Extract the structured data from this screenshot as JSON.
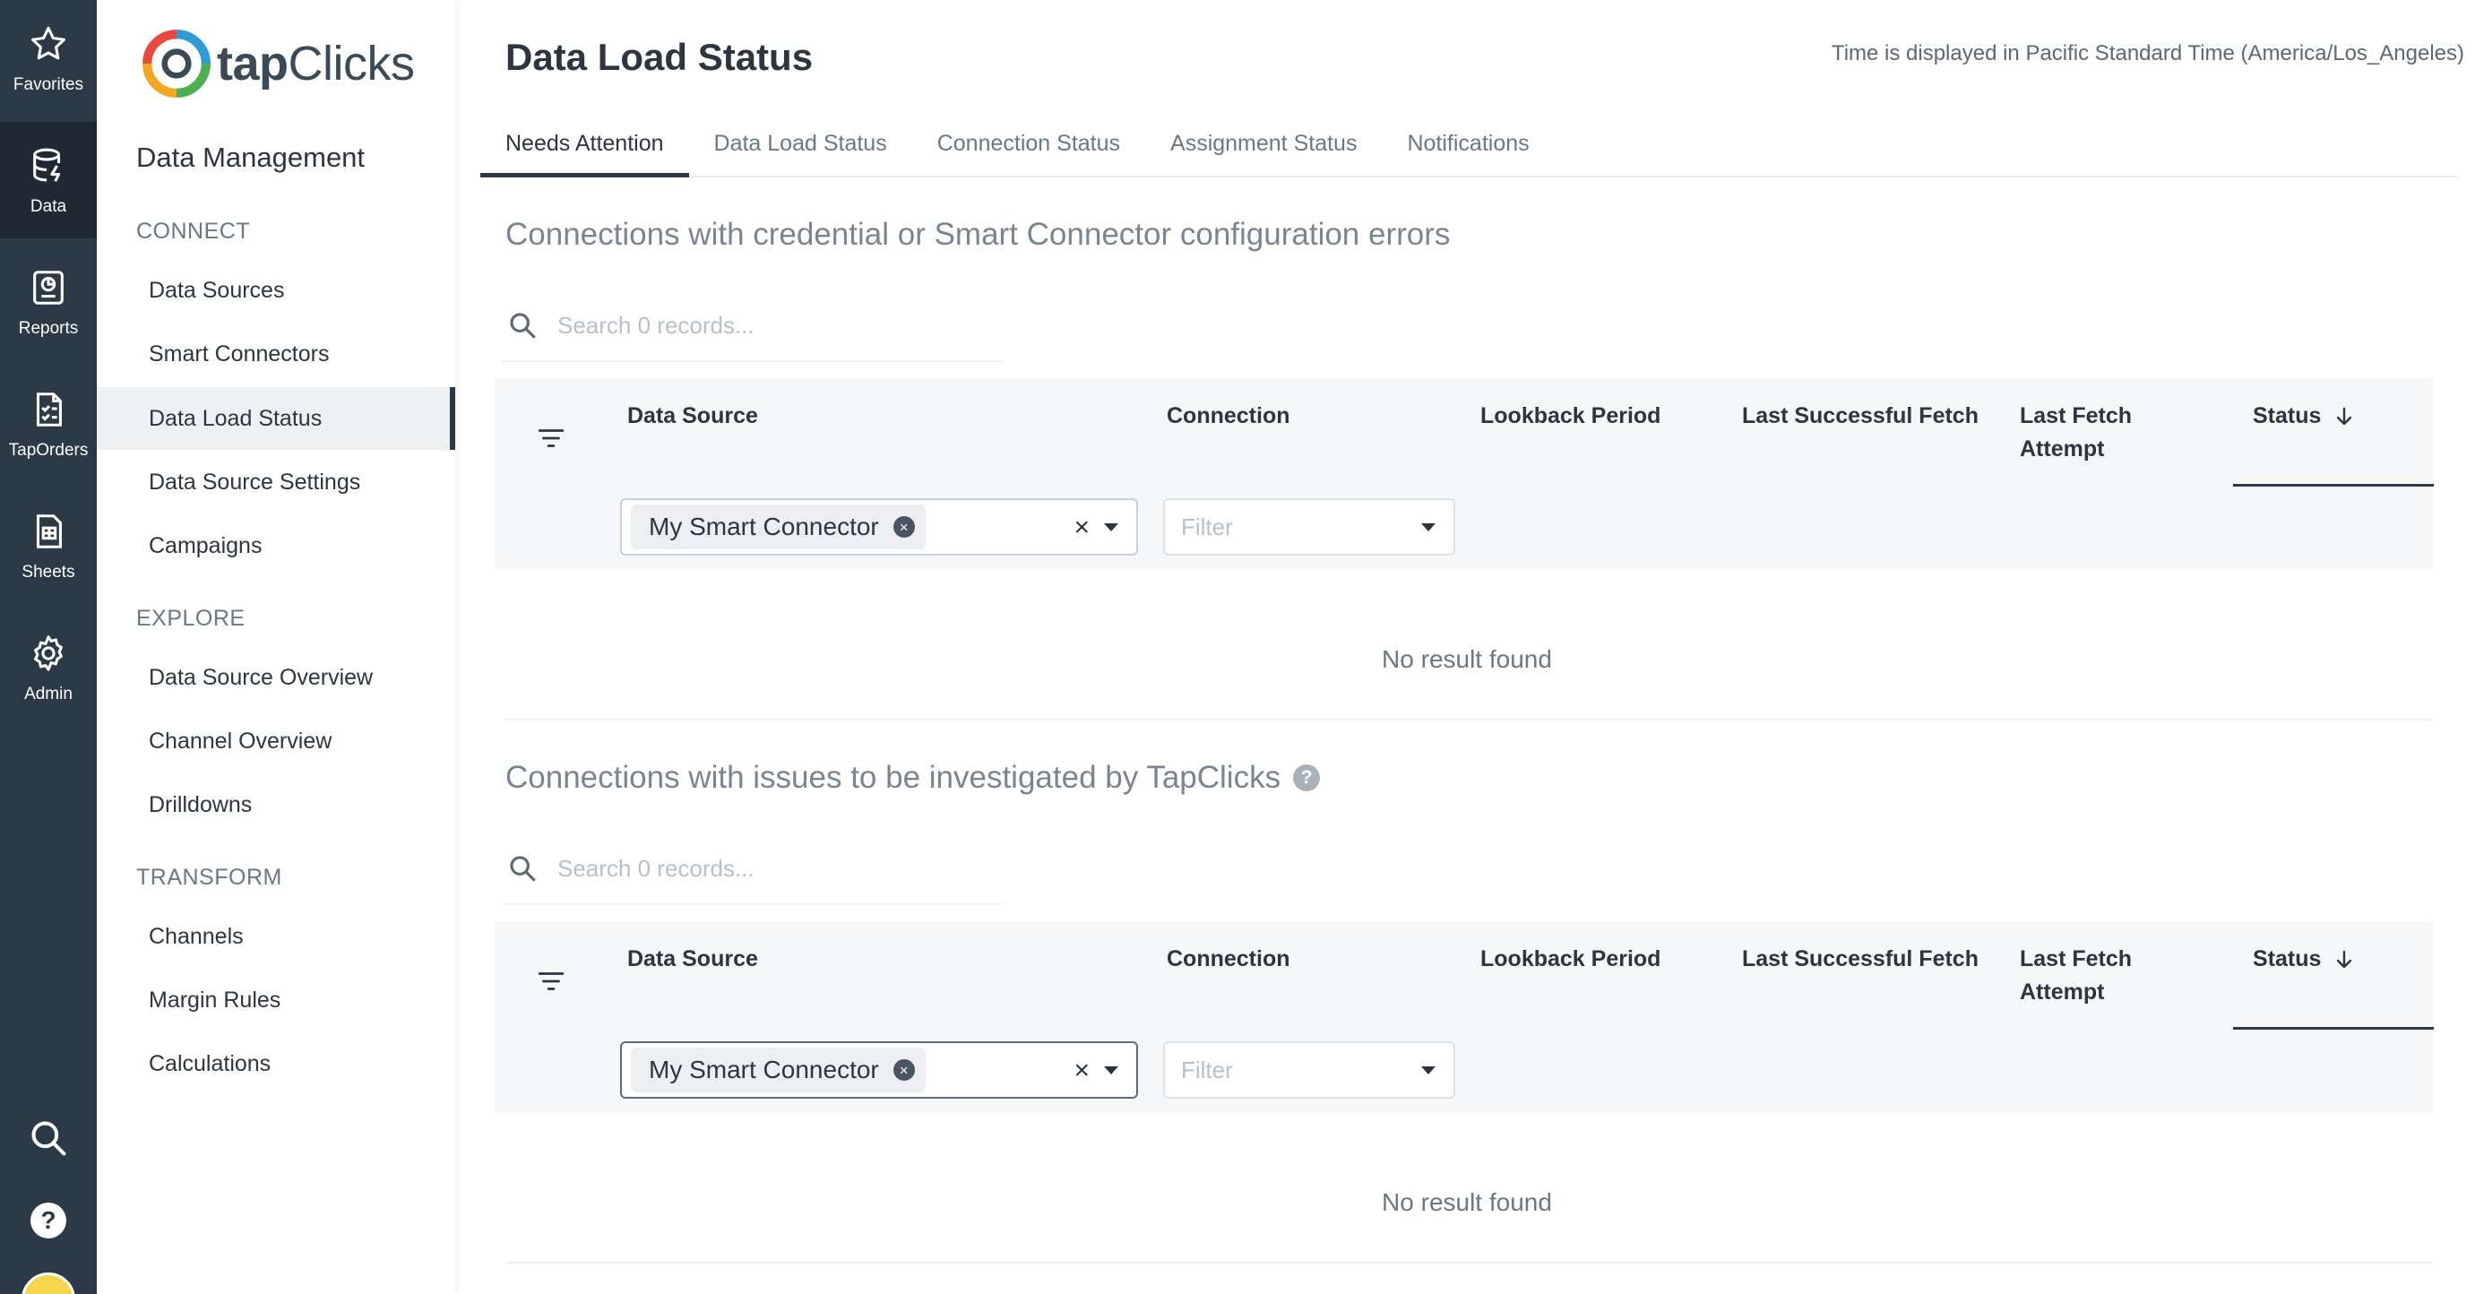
{
  "rail": {
    "items": [
      {
        "label": "Favorites",
        "icon": "star-icon"
      },
      {
        "label": "Data",
        "icon": "database-icon"
      },
      {
        "label": "Reports",
        "icon": "report-icon"
      },
      {
        "label": "TapOrders",
        "icon": "orders-icon"
      },
      {
        "label": "Sheets",
        "icon": "sheets-icon"
      },
      {
        "label": "Admin",
        "icon": "gear-icon"
      }
    ],
    "active": "Data",
    "utility_icons": [
      "search-icon",
      "help-icon",
      "user-avatar"
    ],
    "help_glyph": "?"
  },
  "sidebar": {
    "logo": {
      "part1": "tap",
      "part2": "Clicks"
    },
    "title": "Data Management",
    "sections": [
      {
        "label": "CONNECT",
        "items": [
          "Data Sources",
          "Smart Connectors",
          "Data Load Status",
          "Data Source Settings",
          "Campaigns"
        ]
      },
      {
        "label": "EXPLORE",
        "items": [
          "Data Source Overview",
          "Channel Overview",
          "Drilldowns"
        ]
      },
      {
        "label": "TRANSFORM",
        "items": [
          "Channels",
          "Margin Rules",
          "Calculations"
        ]
      }
    ],
    "active_item": "Data Load Status"
  },
  "main": {
    "title": "Data Load Status",
    "timezone_note": "Time is displayed in Pacific Standard Time (America/Los_Angeles)",
    "tabs": [
      "Needs Attention",
      "Data Load Status",
      "Connection Status",
      "Assignment Status",
      "Notifications"
    ],
    "active_tab": "Needs Attention",
    "columns": [
      "Data Source",
      "Connection",
      "Lookback Period",
      "Last Successful Fetch",
      "Last Fetch Attempt",
      "Status"
    ],
    "sort": {
      "column": "Status",
      "direction": "descending"
    },
    "sections": [
      {
        "title": "Connections with credential or Smart Connector configuration errors",
        "search_placeholder": "Search 0 records...",
        "data_source_chip": "My Smart Connector",
        "connection_placeholder": "Filter",
        "empty_text": "No result found",
        "has_help": false
      },
      {
        "title": "Connections with issues to be investigated by TapClicks",
        "search_placeholder": "Search 0 records...",
        "data_source_chip": "My Smart Connector",
        "connection_placeholder": "Filter",
        "empty_text": "No result found",
        "has_help": true,
        "help_glyph": "?"
      }
    ],
    "clear_glyph": "×",
    "chip_remove_glyph": "×"
  },
  "colors": {
    "rail_bg": "#2c3a47",
    "rail_active_bg": "#1e2934",
    "accent": "#2c3a47",
    "logo_ring": [
      "#e8493c",
      "#f5a623",
      "#4caf50",
      "#2f9bd6"
    ]
  }
}
